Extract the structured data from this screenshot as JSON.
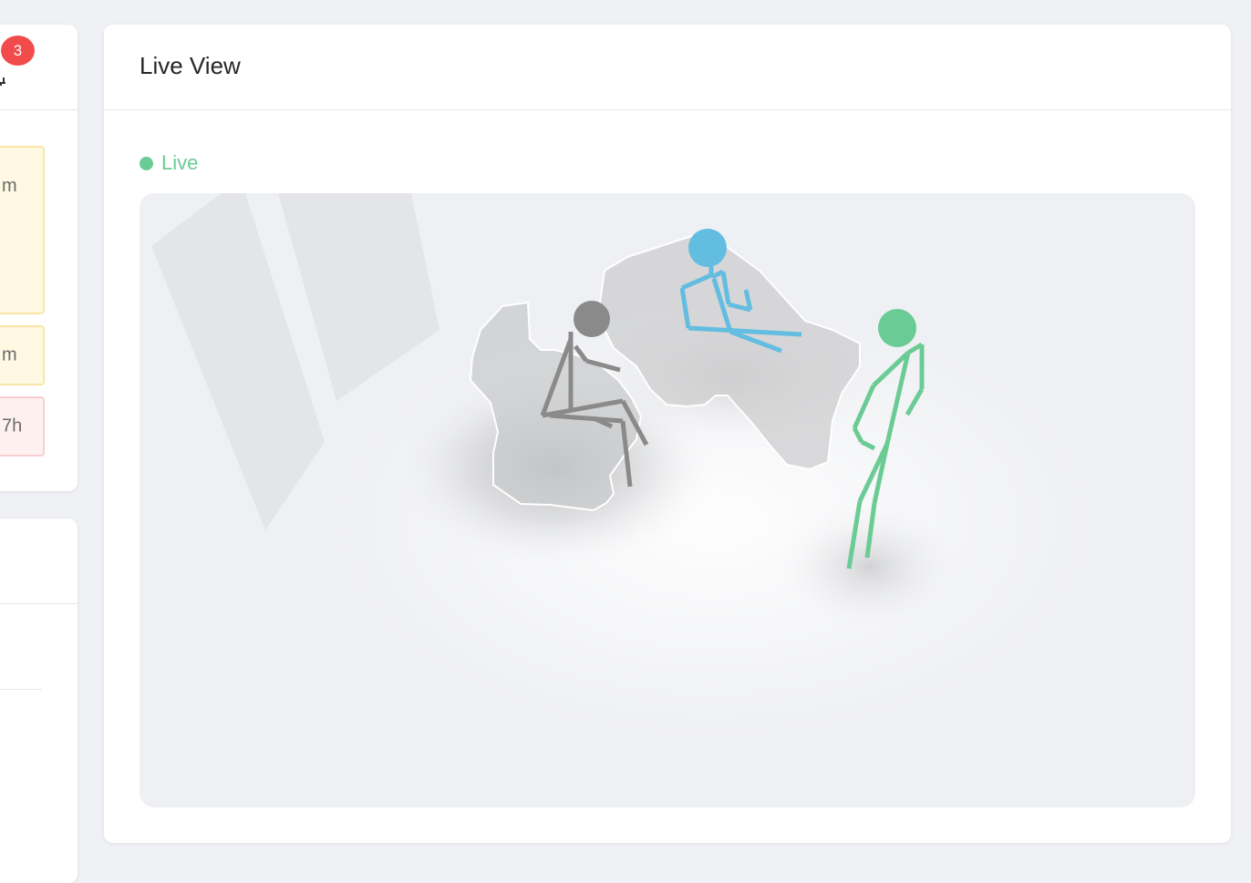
{
  "notifications": {
    "count": "3"
  },
  "alerts": [
    {
      "text": "m"
    },
    {
      "text": "m"
    },
    {
      "text": "7h"
    }
  ],
  "live_view": {
    "title": "Live View",
    "status": "Live",
    "status_color": "#6bcb95"
  },
  "figures": [
    {
      "id": "person-grey",
      "pose": "sitting",
      "color": "#8a8a8a"
    },
    {
      "id": "person-blue",
      "pose": "reclining",
      "color": "#62bde0"
    },
    {
      "id": "person-green",
      "pose": "standing",
      "color": "#6bcb95"
    }
  ]
}
